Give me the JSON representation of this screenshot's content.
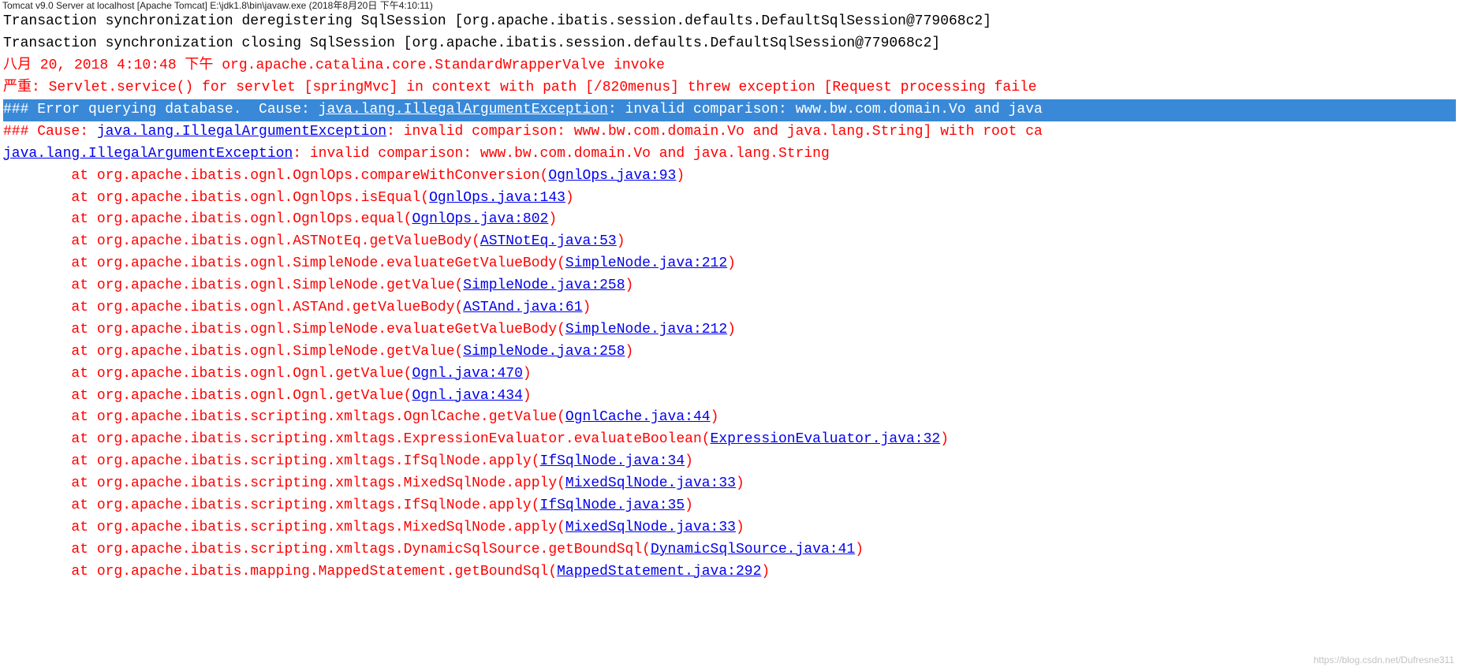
{
  "title": "Tomcat v9.0 Server at localhost [Apache Tomcat] E:\\jdk1.8\\bin\\javaw.exe (2018年8月20日 下午4:10:11)",
  "lines": [
    {
      "type": "plain",
      "color": "black",
      "text": "Transaction synchronization deregistering SqlSession [org.apache.ibatis.session.defaults.DefaultSqlSession@779068c2]"
    },
    {
      "type": "plain",
      "color": "black",
      "text": "Transaction synchronization closing SqlSession [org.apache.ibatis.session.defaults.DefaultSqlSession@779068c2]"
    },
    {
      "type": "plain",
      "color": "red",
      "text": "八月 20, 2018 4:10:48 下午 org.apache.catalina.core.StandardWrapperValve invoke"
    },
    {
      "type": "plain",
      "color": "red",
      "text": "严重: Servlet.service() for servlet [springMvc] in context with path [/820menus] threw exception [Request processing faile"
    },
    {
      "type": "selected",
      "segs": [
        {
          "t": "### Error querying database.  Cause: "
        },
        {
          "t": "java.lang.IllegalArgumentException",
          "link": true
        },
        {
          "t": ": invalid comparison: www.bw.com.domain.Vo and java"
        }
      ]
    },
    {
      "type": "mix",
      "segs": [
        {
          "t": "### Cause: ",
          "c": "red"
        },
        {
          "t": "java.lang.IllegalArgumentException",
          "link": true
        },
        {
          "t": ": invalid comparison: www.bw.com.domain.Vo and java.lang.String] with root ca",
          "c": "red"
        }
      ]
    },
    {
      "type": "mix",
      "segs": [
        {
          "t": "java.lang.IllegalArgumentException",
          "link": true
        },
        {
          "t": ": invalid comparison: www.bw.com.domain.Vo and java.lang.String",
          "c": "red"
        }
      ]
    },
    {
      "type": "trace",
      "pre": "        at org.apache.ibatis.ognl.OgnlOps.compareWithConversion(",
      "link": "OgnlOps.java:93",
      "post": ")"
    },
    {
      "type": "trace",
      "pre": "        at org.apache.ibatis.ognl.OgnlOps.isEqual(",
      "link": "OgnlOps.java:143",
      "post": ")"
    },
    {
      "type": "trace",
      "pre": "        at org.apache.ibatis.ognl.OgnlOps.equal(",
      "link": "OgnlOps.java:802",
      "post": ")"
    },
    {
      "type": "trace",
      "pre": "        at org.apache.ibatis.ognl.ASTNotEq.getValueBody(",
      "link": "ASTNotEq.java:53",
      "post": ")"
    },
    {
      "type": "trace",
      "pre": "        at org.apache.ibatis.ognl.SimpleNode.evaluateGetValueBody(",
      "link": "SimpleNode.java:212",
      "post": ")"
    },
    {
      "type": "trace",
      "pre": "        at org.apache.ibatis.ognl.SimpleNode.getValue(",
      "link": "SimpleNode.java:258",
      "post": ")"
    },
    {
      "type": "trace",
      "pre": "        at org.apache.ibatis.ognl.ASTAnd.getValueBody(",
      "link": "ASTAnd.java:61",
      "post": ")"
    },
    {
      "type": "trace",
      "pre": "        at org.apache.ibatis.ognl.SimpleNode.evaluateGetValueBody(",
      "link": "SimpleNode.java:212",
      "post": ")"
    },
    {
      "type": "trace",
      "pre": "        at org.apache.ibatis.ognl.SimpleNode.getValue(",
      "link": "SimpleNode.java:258",
      "post": ")"
    },
    {
      "type": "trace",
      "pre": "        at org.apache.ibatis.ognl.Ognl.getValue(",
      "link": "Ognl.java:470",
      "post": ")"
    },
    {
      "type": "trace",
      "pre": "        at org.apache.ibatis.ognl.Ognl.getValue(",
      "link": "Ognl.java:434",
      "post": ")"
    },
    {
      "type": "trace",
      "pre": "        at org.apache.ibatis.scripting.xmltags.OgnlCache.getValue(",
      "link": "OgnlCache.java:44",
      "post": ")"
    },
    {
      "type": "trace",
      "pre": "        at org.apache.ibatis.scripting.xmltags.ExpressionEvaluator.evaluateBoolean(",
      "link": "ExpressionEvaluator.java:32",
      "post": ")"
    },
    {
      "type": "trace",
      "pre": "        at org.apache.ibatis.scripting.xmltags.IfSqlNode.apply(",
      "link": "IfSqlNode.java:34",
      "post": ")"
    },
    {
      "type": "trace",
      "pre": "        at org.apache.ibatis.scripting.xmltags.MixedSqlNode.apply(",
      "link": "MixedSqlNode.java:33",
      "post": ")"
    },
    {
      "type": "trace",
      "pre": "        at org.apache.ibatis.scripting.xmltags.IfSqlNode.apply(",
      "link": "IfSqlNode.java:35",
      "post": ")"
    },
    {
      "type": "trace",
      "pre": "        at org.apache.ibatis.scripting.xmltags.MixedSqlNode.apply(",
      "link": "MixedSqlNode.java:33",
      "post": ")"
    },
    {
      "type": "trace",
      "pre": "        at org.apache.ibatis.scripting.xmltags.DynamicSqlSource.getBoundSql(",
      "link": "DynamicSqlSource.java:41",
      "post": ")"
    },
    {
      "type": "trace",
      "pre": "        at org.apache.ibatis.mapping.MappedStatement.getBoundSql(",
      "link": "MappedStatement.java:292",
      "post": ")"
    }
  ],
  "watermark": "https://blog.csdn.net/Dufresne311"
}
